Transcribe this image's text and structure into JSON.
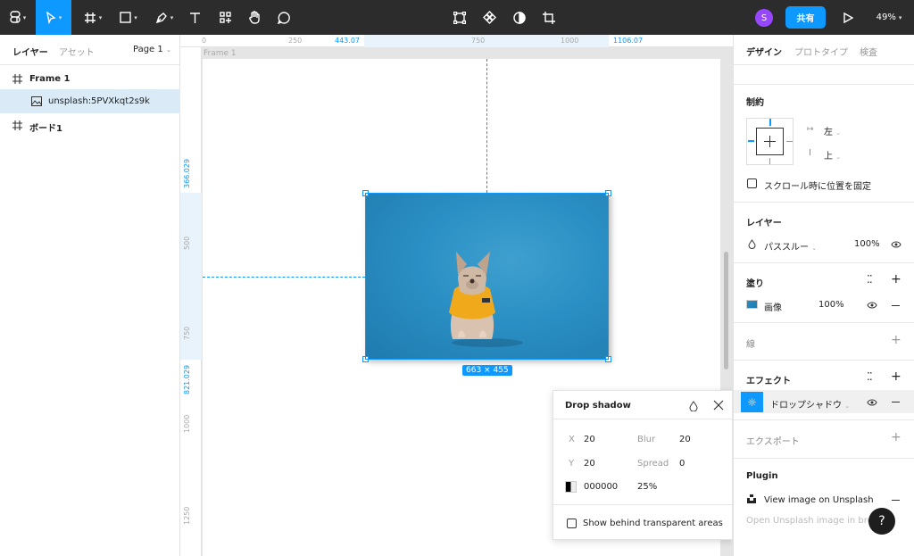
{
  "toolbar": {
    "share_label": "共有",
    "zoom": "49%",
    "avatar_initial": "S",
    "accent": "#0d99ff"
  },
  "left": {
    "tabs": [
      "レイヤー",
      "アセット"
    ],
    "page": "Page 1",
    "layers": [
      {
        "label": "Frame 1"
      },
      {
        "label": "unsplash:5PVXkqt2s9k"
      },
      {
        "label": "ボード1"
      }
    ]
  },
  "canvas": {
    "frame_label": "Frame 1",
    "ruler_top": [
      "0",
      "250",
      "443.07",
      "750",
      "1000",
      "1106.07"
    ],
    "ruler_left": [
      "366.029",
      "500",
      "750",
      "821.029",
      "1000",
      "1250"
    ],
    "size_badge": "663 × 455"
  },
  "drop_shadow": {
    "title": "Drop shadow",
    "x_label": "X",
    "x_value": "20",
    "y_label": "Y",
    "y_value": "20",
    "blur_label": "Blur",
    "blur_value": "20",
    "spread_label": "Spread",
    "spread_value": "0",
    "color": "000000",
    "opacity": "25%",
    "show_behind_label": "Show behind transparent areas"
  },
  "right": {
    "tabs": [
      "デザイン",
      "プロトタイプ",
      "検査"
    ],
    "constraints": {
      "title": "制約",
      "horizontal": "左",
      "vertical": "上",
      "fix_scroll": "スクロール時に位置を固定"
    },
    "layer": {
      "title": "レイヤー",
      "blend": "パススルー",
      "opacity": "100%"
    },
    "fill": {
      "title": "塗り",
      "type": "画像",
      "opacity": "100%"
    },
    "stroke": {
      "title": "線"
    },
    "effects": {
      "title": "エフェクト",
      "item": "ドロップシャドウ"
    },
    "export": {
      "title": "エクスポート"
    },
    "plugin": {
      "title": "Plugin",
      "item": "View image on Unsplash",
      "sub": "Open Unsplash image in browser"
    }
  },
  "help_label": "?"
}
